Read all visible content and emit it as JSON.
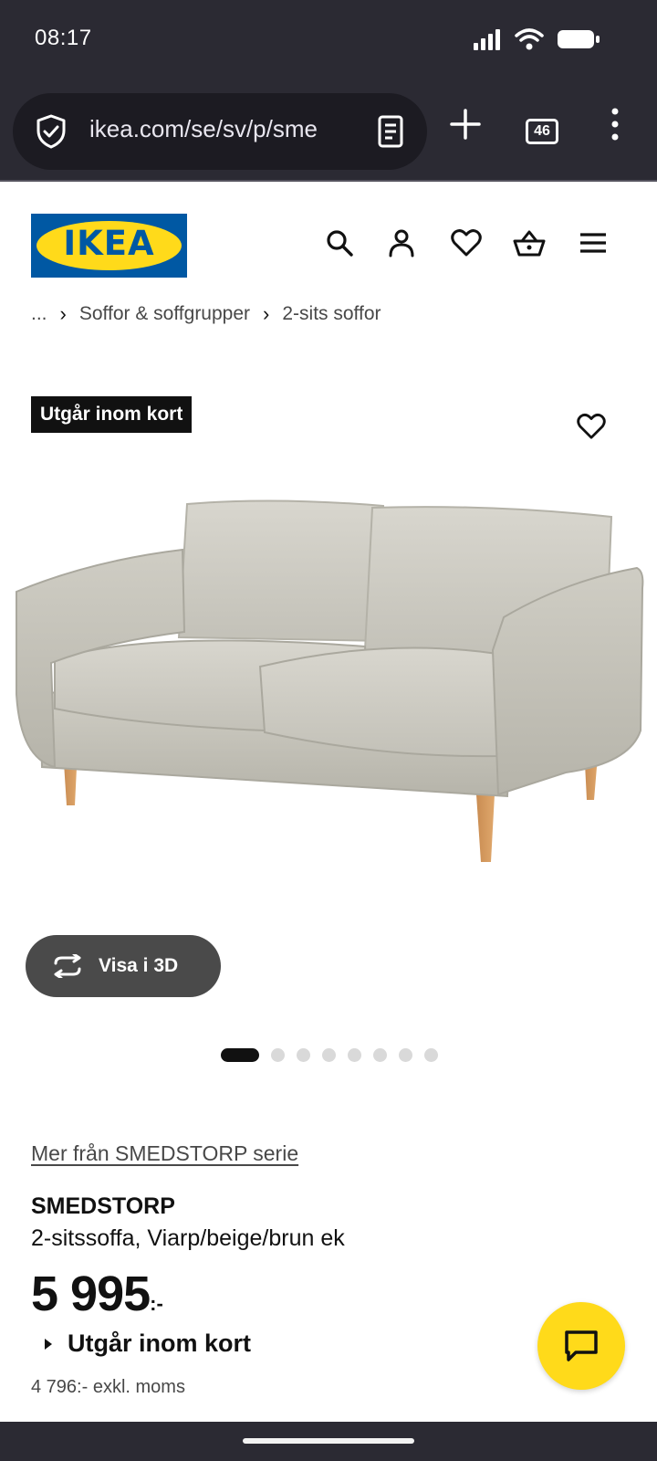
{
  "status_bar": {
    "time": "08:17",
    "icons": [
      "signal-icon",
      "wifi-icon",
      "battery-icon"
    ]
  },
  "browser": {
    "url": "ikea.com/se/sv/p/sme",
    "tab_count": "46",
    "icons": [
      "shield-icon",
      "reader-mode-icon",
      "new-tab-icon",
      "tabs-icon",
      "menu-dots-icon"
    ]
  },
  "header": {
    "logo_text": "IKEA",
    "icons": [
      "search-icon",
      "account-icon",
      "favourites-icon",
      "cart-icon",
      "hamburger-menu-icon"
    ]
  },
  "breadcrumb": {
    "items": [
      "...",
      "Soffor & soffgrupper",
      "2-sits soffor"
    ]
  },
  "product": {
    "badge": "Utgår inom kort",
    "view_3d_label": "Visa i 3D",
    "image_count": 8,
    "active_image_index": 1,
    "series_link": "Mer från SMEDSTORP serie",
    "name": "SMEDSTORP",
    "description": "2-sitssoffa, Viarp/beige/brun ek",
    "price": "5 995",
    "price_suffix": ":-",
    "status": "Utgår inom kort",
    "price_excl_vat": "4 796:- exkl. moms"
  },
  "colors": {
    "brand_blue": "#0058a3",
    "brand_yellow": "#ffda1a",
    "browser_chrome": "#2b2a33"
  }
}
